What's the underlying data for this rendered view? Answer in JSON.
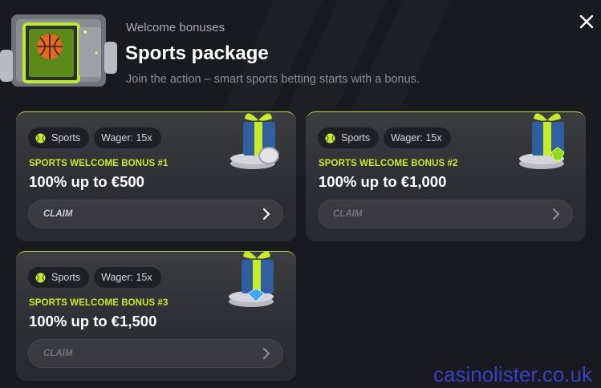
{
  "header": {
    "eyebrow": "Welcome bonuses",
    "title": "Sports package",
    "subtitle": "Join the action – smart sports betting starts with a bonus."
  },
  "icons": {
    "chest": "treasure-chest-basketball-icon",
    "close": "close-icon",
    "sport": "tennis-ball-icon",
    "chevron": "chevron-right-icon",
    "gift": "gift-box-icon"
  },
  "colors": {
    "accent": "#c6ec2a",
    "background": "#191a20",
    "card": "#2e2f35"
  },
  "cards": [
    {
      "tag_sport": "Sports",
      "tag_wager": "Wager: 15x",
      "label": "SPORTS WELCOME BONUS #1",
      "amount": "100% up to €500",
      "claim": "CLAIM"
    },
    {
      "tag_sport": "Sports",
      "tag_wager": "Wager: 15x",
      "label": "SPORTS WELCOME BONUS #2",
      "amount": "100% up to €1,000",
      "claim": "CLAIM"
    },
    {
      "tag_sport": "Sports",
      "tag_wager": "Wager: 15x",
      "label": "SPORTS WELCOME BONUS #3",
      "amount": "100% up to €1,500",
      "claim": "CLAIM"
    }
  ],
  "watermark": "casinolister.co.uk"
}
